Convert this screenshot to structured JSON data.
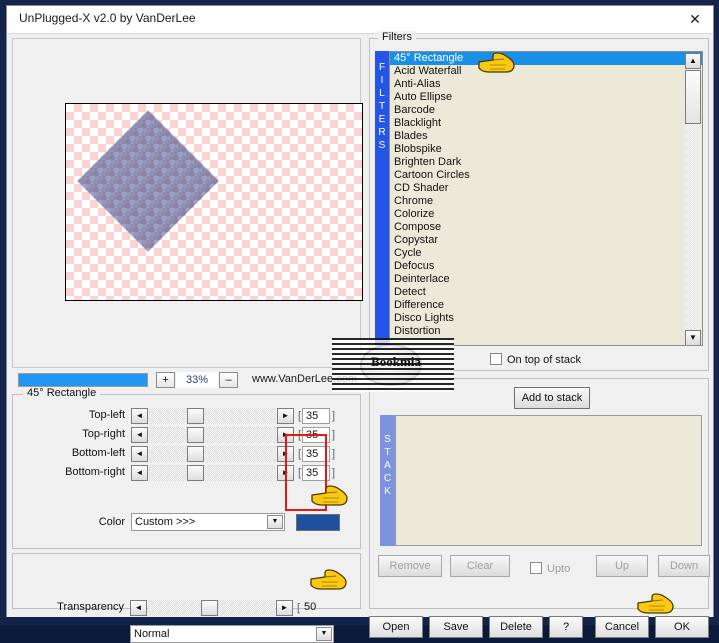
{
  "window": {
    "title": "UnPlugged-X v2.0 by VanDerLee",
    "close_icon": "close-icon"
  },
  "preview": {
    "zoom_value": "33%",
    "zoom_in_label": "+",
    "zoom_out_label": "–",
    "website": "www.VanDerLee.com",
    "progress_percent": 100
  },
  "params": {
    "legend": "45° Rectangle",
    "rows": [
      {
        "label": "Top-left",
        "value": "35",
        "thumb_percent": 38
      },
      {
        "label": "Top-right",
        "value": "35",
        "thumb_percent": 38
      },
      {
        "label": "Bottom-left",
        "value": "35",
        "thumb_percent": 38
      },
      {
        "label": "Bottom-right",
        "value": "35",
        "thumb_percent": 38
      }
    ],
    "bracket_left": "[",
    "bracket_right": "]",
    "arrow_left": "◄",
    "arrow_right": "►",
    "color_label": "Color",
    "color_value": "Custom >>>",
    "color_swatch_hex": "#1f4f9e",
    "combo_arrow": "▼",
    "highlight_color": "#e81717"
  },
  "transparency": {
    "label": "Transparency",
    "value": "50",
    "thumb_percent": 50,
    "blend_mode": "Normal"
  },
  "filters": {
    "legend": "Filters",
    "sidebar_text": "FILTERS",
    "selected": "45° Rectangle",
    "items": [
      "45° Rectangle",
      "Acid Waterfall",
      "Anti-Alias",
      "Auto Ellipse",
      "Barcode",
      "Blacklight",
      "Blades",
      "Blobspike",
      "Brighten Dark",
      "Cartoon Circles",
      "CD Shader",
      "Chrome",
      "Colorize",
      "Compose",
      "Copystar",
      "Cycle",
      "Defocus",
      "Deinterlace",
      "Detect",
      "Difference",
      "Disco Lights",
      "Distortion"
    ],
    "scroll_up_icon": "▲",
    "scroll_down_icon": "▼",
    "on_top_label": "On top of stack",
    "on_top_checked": false
  },
  "stack": {
    "sidebar_text": "STACK",
    "add_label": "Add to stack",
    "items": [],
    "buttons": [
      {
        "label": "Remove",
        "disabled": true
      },
      {
        "label": "Clear",
        "disabled": true
      },
      {
        "label": "Up",
        "disabled": true
      },
      {
        "label": "Down",
        "disabled": true
      }
    ],
    "upto_label": "Upto",
    "upto_checked": false
  },
  "bottom_buttons": [
    {
      "label": "Open"
    },
    {
      "label": "Save"
    },
    {
      "label": "Delete"
    },
    {
      "label": "?"
    },
    {
      "label": "Cancel"
    },
    {
      "label": "OK"
    }
  ],
  "watermark": {
    "text": "Bookmia"
  }
}
